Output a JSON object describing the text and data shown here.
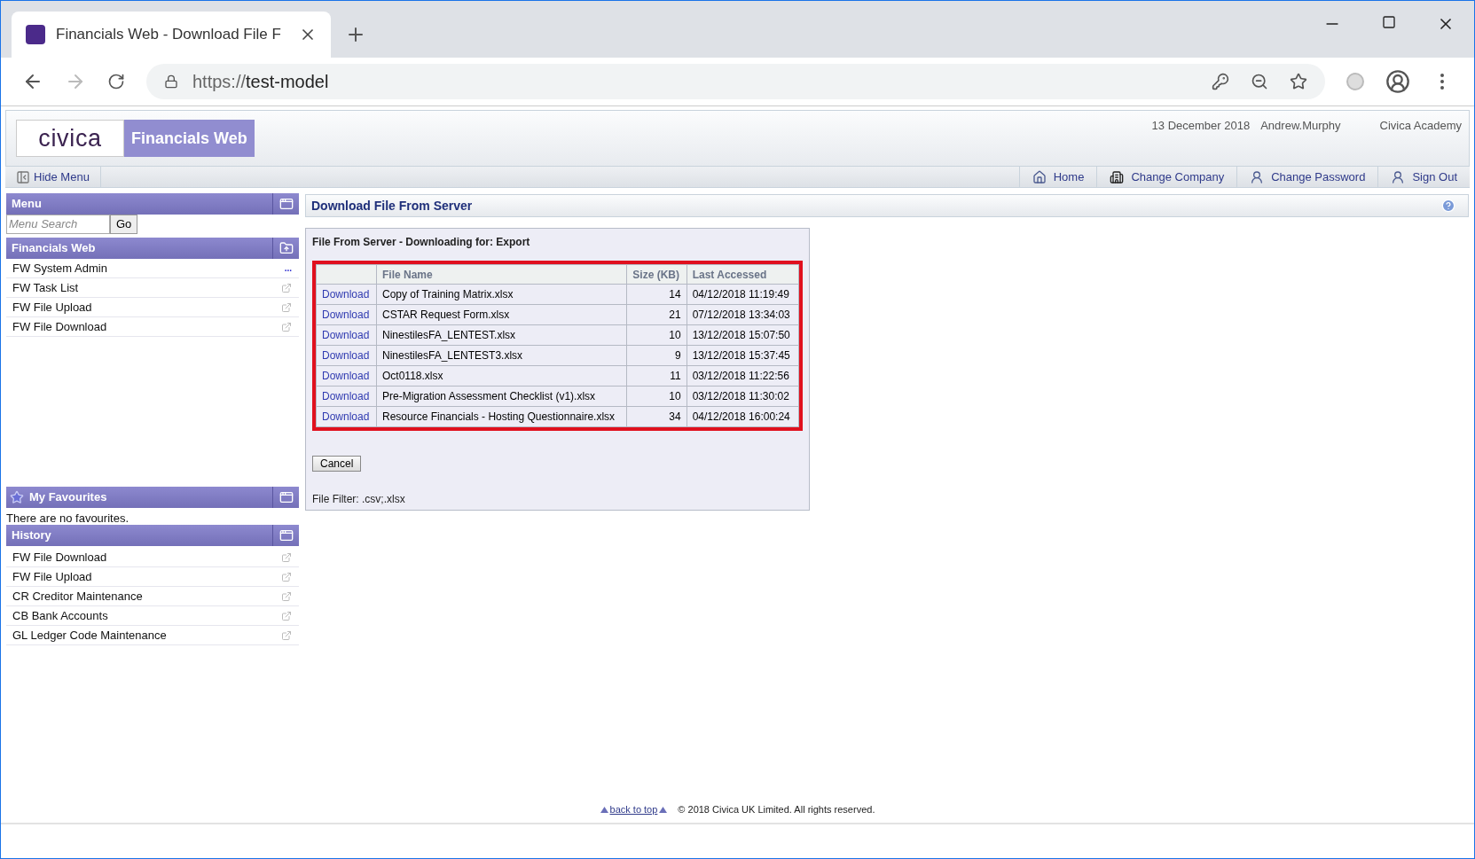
{
  "browser": {
    "tab_title": "Financials Web - Download File F",
    "url_scheme": "https://",
    "url_host": "test-model"
  },
  "header": {
    "logo": "civica",
    "product": "Financials Web",
    "date": "13 December 2018",
    "user": "Andrew.Murphy",
    "company": "Civica Academy"
  },
  "toolbar": {
    "hide_menu": "Hide Menu",
    "links": [
      {
        "label": "Home",
        "kind": "home"
      },
      {
        "label": "Change Company",
        "kind": "company"
      },
      {
        "label": "Change Password",
        "kind": "user"
      },
      {
        "label": "Sign Out",
        "kind": "user"
      }
    ]
  },
  "sidebar": {
    "menu_title": "Menu",
    "search": {
      "placeholder": "Menu Search",
      "button": "Go"
    },
    "section_title": "Financials Web",
    "items": [
      {
        "label": "FW System Admin",
        "kind": "more",
        "marker": "..."
      },
      {
        "label": "FW Task List",
        "kind": "link"
      },
      {
        "label": "FW File Upload",
        "kind": "link"
      },
      {
        "label": "FW File Download",
        "kind": "link"
      }
    ],
    "favourites_title": "My Favourites",
    "favourites_empty": "There are no favourites.",
    "history_title": "History",
    "history": [
      {
        "label": "FW File Download"
      },
      {
        "label": "FW File Upload"
      },
      {
        "label": "CR Creditor Maintenance"
      },
      {
        "label": "CB Bank Accounts"
      },
      {
        "label": "GL Ledger Code Maintenance"
      }
    ]
  },
  "page": {
    "title": "Download File From Server",
    "panel_title": "File From Server - Downloading for: Export",
    "table": {
      "columns": [
        "File Name",
        "Size (KB)",
        "Last Accessed"
      ],
      "rows": [
        {
          "action": "Download",
          "name": "Copy of Training Matrix.xlsx",
          "size": "14",
          "accessed": "04/12/2018 11:19:49"
        },
        {
          "action": "Download",
          "name": "CSTAR Request Form.xlsx",
          "size": "21",
          "accessed": "07/12/2018 13:34:03"
        },
        {
          "action": "Download",
          "name": "NinestilesFA_LENTEST.xlsx",
          "size": "10",
          "accessed": "13/12/2018 15:07:50"
        },
        {
          "action": "Download",
          "name": "NinestilesFA_LENTEST3.xlsx",
          "size": "9",
          "accessed": "13/12/2018 15:37:45"
        },
        {
          "action": "Download",
          "name": "Oct0118.xlsx",
          "size": "11",
          "accessed": "03/12/2018 11:22:56"
        },
        {
          "action": "Download",
          "name": "Pre-Migration Assessment Checklist (v1).xlsx",
          "size": "10",
          "accessed": "03/12/2018 11:30:02"
        },
        {
          "action": "Download",
          "name": "Resource Financials - Hosting Questionnaire.xlsx",
          "size": "34",
          "accessed": "04/12/2018 16:00:24"
        }
      ]
    },
    "cancel": "Cancel",
    "file_filter": "File Filter: .csv;.xlsx"
  },
  "footer": {
    "back_to_top": "back to top",
    "copyright": "© 2018 Civica UK Limited. All rights reserved."
  }
}
